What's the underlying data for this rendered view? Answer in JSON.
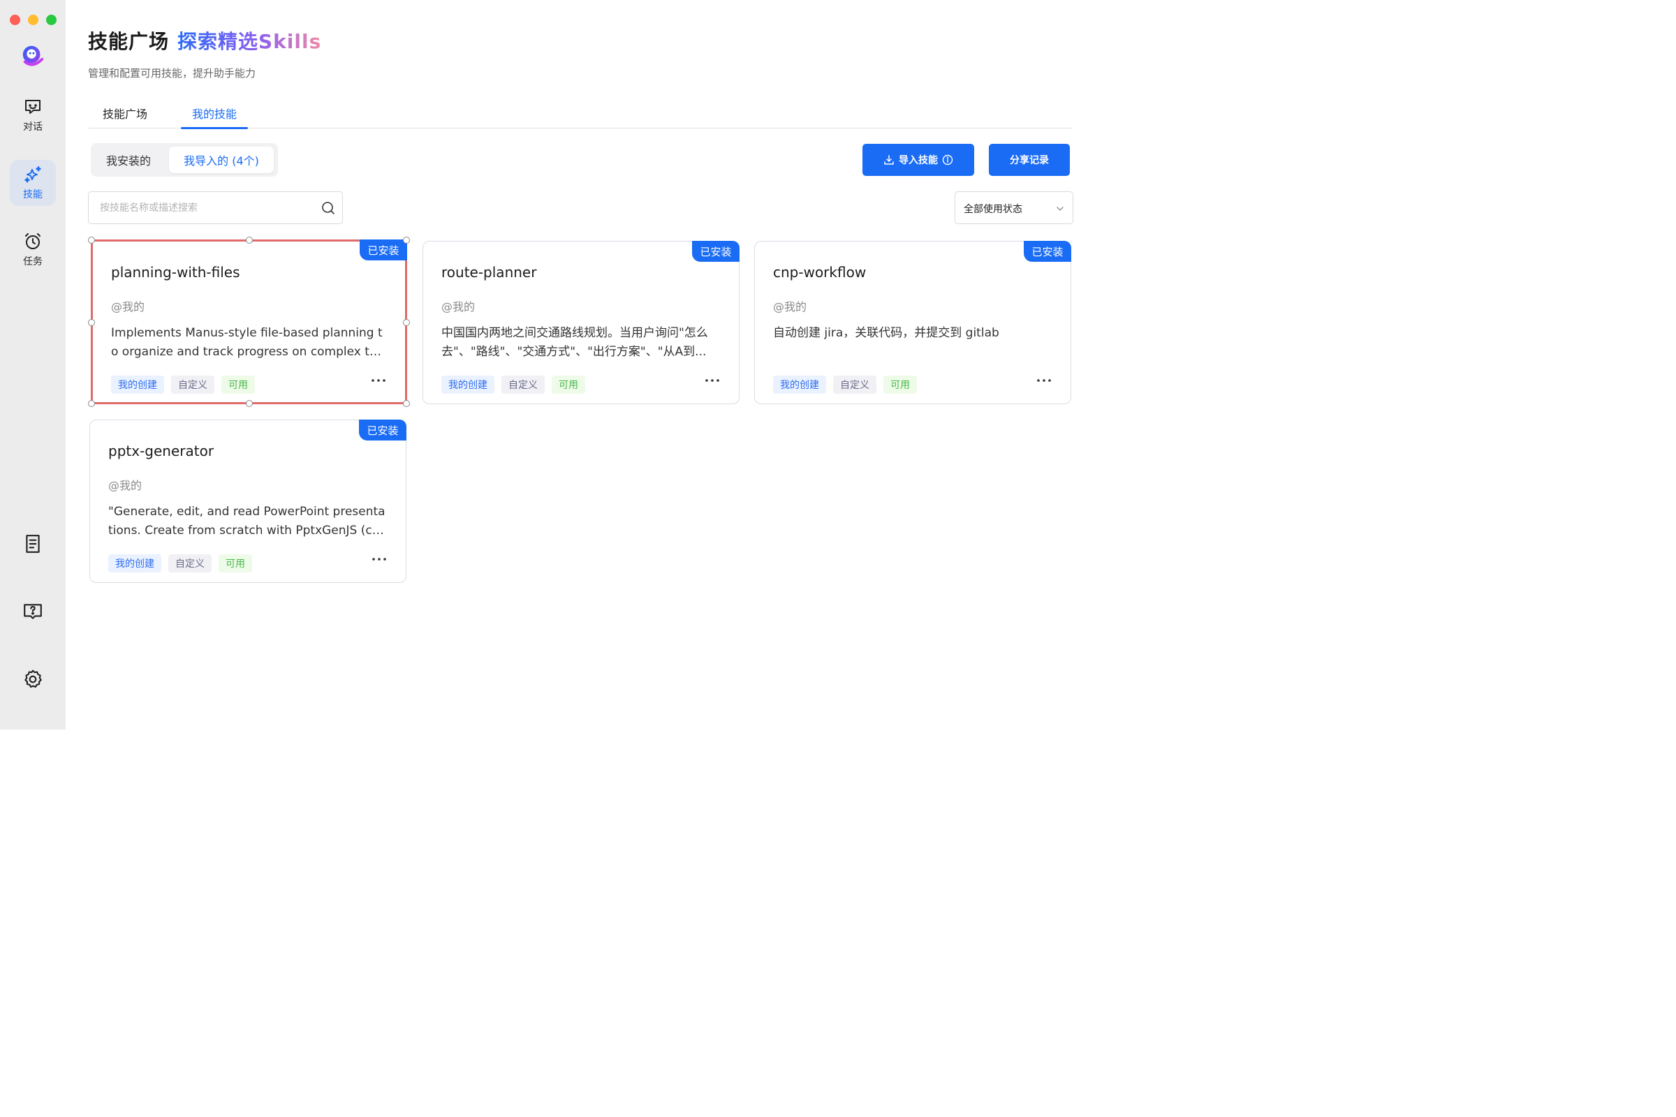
{
  "sidebar": {
    "items": [
      {
        "label": "对话",
        "icon": "chat-icon"
      },
      {
        "label": "技能",
        "icon": "sparkle-icon"
      },
      {
        "label": "任务",
        "icon": "alarm-clock-icon"
      }
    ],
    "bottom_icons": [
      "document-icon",
      "help-icon",
      "gear-icon"
    ]
  },
  "header": {
    "title": "技能广场",
    "title_accent": "探索精选Skills",
    "subtitle": "管理和配置可用技能，提升助手能力"
  },
  "tabs": [
    "技能广场",
    "我的技能"
  ],
  "segmented": [
    "我安装的",
    "我导入的 (4个)"
  ],
  "buttons": {
    "import": "导入技能",
    "share": "分享记录"
  },
  "search": {
    "placeholder": "按技能名称或描述搜索",
    "value": ""
  },
  "filter": {
    "selected": "全部使用状态"
  },
  "colors": {
    "accent": "#1a6cf5",
    "selection": "#e06a6a"
  },
  "cards": [
    {
      "badge": "已安装",
      "title": "planning-with-files",
      "author": "@我的",
      "description": "Implements Manus-style file-based planning to organize and track progress on complex tasks...",
      "tags": [
        "我的创建",
        "自定义",
        "可用"
      ]
    },
    {
      "badge": "已安装",
      "title": "route-planner",
      "author": "@我的",
      "description": "中国国内两地之间交通路线规划。当用户询问\"怎么去\"、\"路线\"、\"交通方式\"、\"出行方案\"、\"从A到...",
      "tags": [
        "我的创建",
        "自定义",
        "可用"
      ]
    },
    {
      "badge": "已安装",
      "title": "cnp-workflow",
      "author": "@我的",
      "description": "自动创建 jira，关联代码，并提交到 gitlab",
      "tags": [
        "我的创建",
        "自定义",
        "可用"
      ]
    },
    {
      "badge": "已安装",
      "title": "pptx-generator",
      "author": "@我的",
      "description": "\"Generate, edit, and read PowerPoint presentations. Create from scratch with PptxGenJS (co...",
      "tags": [
        "我的创建",
        "自定义",
        "可用"
      ]
    }
  ]
}
